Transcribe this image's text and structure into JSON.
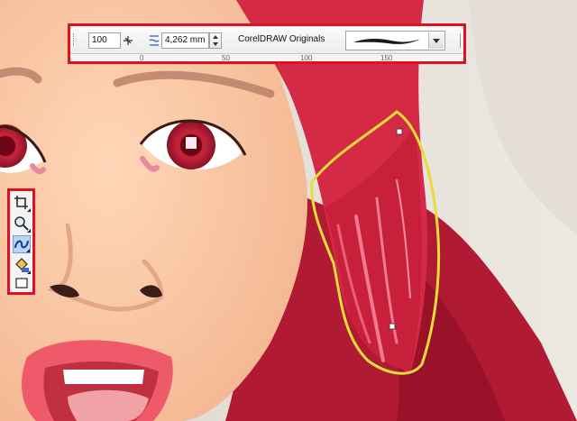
{
  "propertybar": {
    "size_value": "100",
    "width_value": "4,262 mm",
    "preset_category": "CorelDRAW Originals",
    "ruler_labels": [
      "0",
      "50",
      "100",
      "150"
    ],
    "icons": [
      "scale-lock-icon",
      "stroke-width-icon",
      "brush-stroke-preview",
      "dropdown-arrow-icon"
    ]
  },
  "toolbox": {
    "tools": [
      {
        "name": "crop-tool",
        "active": false
      },
      {
        "name": "zoom-tool",
        "active": false
      },
      {
        "name": "artistic-media-tool",
        "active": true
      },
      {
        "name": "smart-fill-tool",
        "active": false
      },
      {
        "name": "rectangle-tool",
        "active": false
      }
    ]
  },
  "colors": {
    "highlight_border": "#e01020",
    "hair": "#d42a45",
    "skin": "#fbc9a5",
    "selection_path": "#e6dd3a",
    "active_tool": "#b9d6f5"
  }
}
